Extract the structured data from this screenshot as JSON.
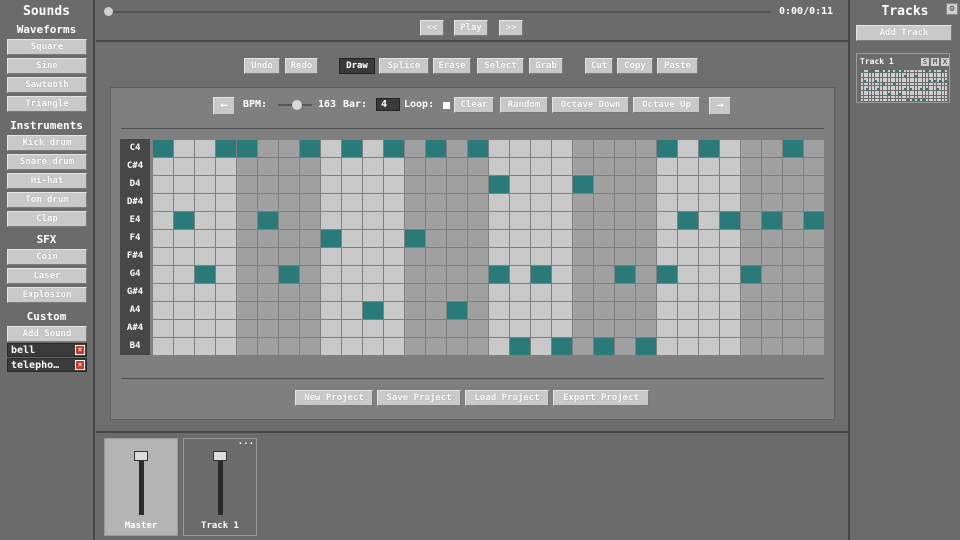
{
  "sounds": {
    "title": "Sounds",
    "waveforms": {
      "title": "Waveforms",
      "items": [
        "Square",
        "Sine",
        "Sawtooth",
        "Triangle"
      ]
    },
    "instruments": {
      "title": "Instruments",
      "items": [
        "Kick drum",
        "Snare drum",
        "Hi-hat",
        "Tom drum",
        "Clap"
      ]
    },
    "sfx": {
      "title": "SFX",
      "items": [
        "Coin",
        "Laser",
        "Explosion"
      ]
    },
    "custom": {
      "title": "Custom",
      "add_label": "Add Sound",
      "items": [
        "bell",
        "telepho…"
      ],
      "delete_glyph": "×"
    }
  },
  "transport": {
    "time": "0:00/0:11",
    "rewind_label": "<<",
    "play_label": "Play",
    "forward_label": ">>",
    "progress": 0.0
  },
  "toolbar": {
    "undo": "Undo",
    "redo": "Redo",
    "tools": [
      "Draw",
      "Splice",
      "Erase",
      "Select",
      "Grab"
    ],
    "active_tool": "Draw",
    "cut": "Cut",
    "copy": "Copy",
    "paste": "Paste"
  },
  "sequencer": {
    "prev_glyph": "←",
    "next_glyph": "→",
    "bpm_label": "BPM:",
    "bpm_value": "163",
    "bar_label": "Bar:",
    "bar_value": "4",
    "loop_label": "Loop:",
    "loop_checked": false,
    "clear": "Clear",
    "random": "Random",
    "octave_down": "Octave Down",
    "octave_up": "Octave Up",
    "notes": [
      "C4",
      "C#4",
      "D4",
      "D#4",
      "E4",
      "F4",
      "F#4",
      "G4",
      "G#4",
      "A4",
      "A#4",
      "B4"
    ],
    "steps": 32,
    "active_cells": [
      [
        0,
        0
      ],
      [
        0,
        3
      ],
      [
        0,
        4
      ],
      [
        0,
        7
      ],
      [
        0,
        9
      ],
      [
        0,
        11
      ],
      [
        0,
        13
      ],
      [
        0,
        15
      ],
      [
        0,
        24
      ],
      [
        0,
        26
      ],
      [
        0,
        30
      ],
      [
        2,
        16
      ],
      [
        2,
        20
      ],
      [
        4,
        1
      ],
      [
        4,
        5
      ],
      [
        4,
        25
      ],
      [
        4,
        27
      ],
      [
        4,
        29
      ],
      [
        4,
        31
      ],
      [
        5,
        8
      ],
      [
        5,
        12
      ],
      [
        7,
        2
      ],
      [
        7,
        6
      ],
      [
        7,
        16
      ],
      [
        7,
        18
      ],
      [
        7,
        22
      ],
      [
        7,
        24
      ],
      [
        7,
        28
      ],
      [
        9,
        10
      ],
      [
        9,
        14
      ],
      [
        11,
        17
      ],
      [
        11,
        19
      ],
      [
        11,
        21
      ],
      [
        11,
        23
      ]
    ],
    "accent_color": "#2b7a7a"
  },
  "project": {
    "new": "New Project",
    "save": "Save Project",
    "load": "Load Project",
    "export": "Export Project"
  },
  "tracks": {
    "title": "Tracks",
    "settings_glyph": "⚙",
    "add_label": "Add Track",
    "items": [
      {
        "name": "Track 1",
        "solo": "S",
        "mute": "M",
        "close": "X"
      }
    ]
  },
  "mixer": {
    "strips": [
      {
        "name": "Master"
      },
      {
        "name": "Track 1",
        "menu": "..."
      }
    ]
  }
}
